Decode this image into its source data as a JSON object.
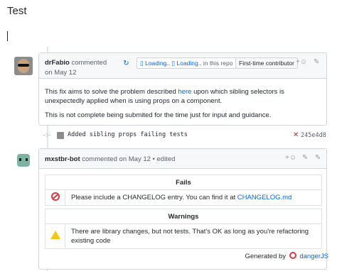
{
  "page": {
    "title": "Test"
  },
  "comment1": {
    "author": "drFabio",
    "action": "commented",
    "date": "on May 12",
    "loading_1": "Loading..",
    "loading_2": "Loading..",
    "loading_suffix": "in this repo",
    "badge": "First-time contributor",
    "body_p1_before": "This fix aims to solve the problem described ",
    "body_p1_link": "here",
    "body_p1_after": " upon which sibling selectors is unexpectedly applied when is using props on a component.",
    "body_p2": "This is not complete being submited for the time just for input and guidance."
  },
  "commit": {
    "message": "Added sibling props failing tests",
    "status_icon": "x-icon",
    "sha": "245e4d8"
  },
  "comment2": {
    "author": "mxstbr-bot",
    "meta": "commented on May 12 • edited",
    "fails_header": "Fails",
    "fails_text": "Please include a CHANGELOG entry. You can find it at ",
    "fails_link": "CHANGELOG.md",
    "warnings_header": "Warnings",
    "warnings_text": "There are library changes, but not tests. That's OK as long as you're refactoring existing code",
    "generated_by": "Generated by",
    "generated_link": "dangerJS"
  },
  "icons": {
    "sync": "sync-icon",
    "reaction": "smiley-icon",
    "edit": "pencil-icon",
    "commit": "git-commit-icon"
  },
  "colors": {
    "link": "#0366d6",
    "danger": "#d73a49",
    "warning": "#f5c518"
  }
}
